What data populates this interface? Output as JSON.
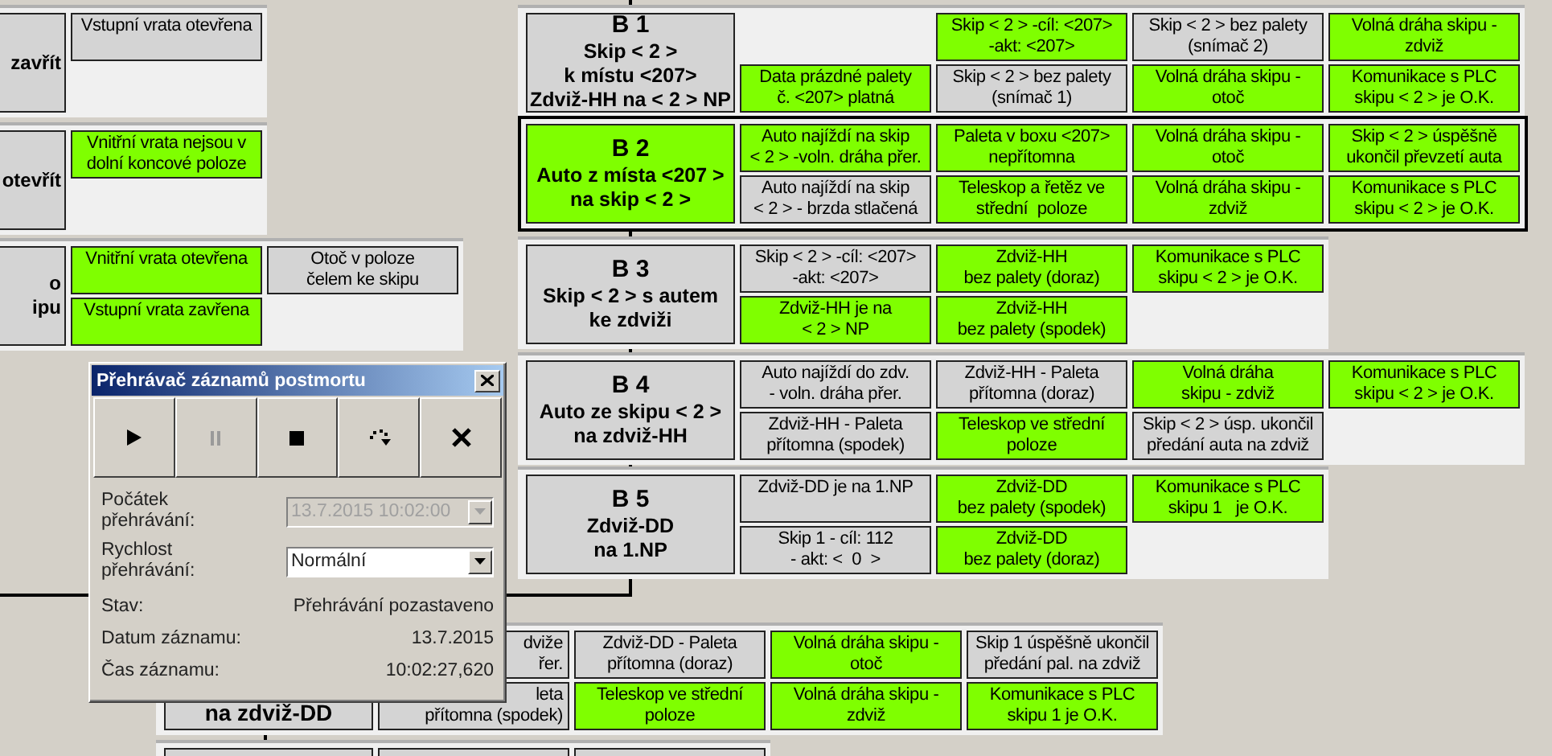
{
  "blocks": [
    {
      "selected": false,
      "title": {
        "on": false,
        "text": "zavřít"
      },
      "rows": [
        [
          {
            "text": "Vstupní vrata otevřena",
            "on": false
          }
        ]
      ]
    },
    {
      "selected": false,
      "title": {
        "on": false,
        "text": "otevřít"
      },
      "rows": [
        [
          {
            "text": "Vnitřní vrata nejsou v\ndolní koncové poloze",
            "on": true
          }
        ]
      ]
    },
    {
      "selected": false,
      "title": {
        "on": false,
        "text": "o\nipu"
      },
      "rows": [
        [
          {
            "text": "Vnitřní vrata otevřena",
            "on": true
          },
          {
            "text": "Otoč v poloze\nčelem ke skipu",
            "on": false
          }
        ],
        [
          {
            "text": "Vstupní vrata zavřena",
            "on": true
          }
        ]
      ]
    },
    {
      "selected": false,
      "title": {
        "on": false,
        "code": "B 1",
        "text": "Skip < 2 >\nk místu <207>\nZdviž-HH na < 2 > NP"
      },
      "rows": [
        [
          null,
          {
            "text": "Skip < 2 > -cíl: <207>\n-akt: <207>",
            "on": true
          },
          {
            "text": "Skip < 2 > bez palety\n(snímač 2)",
            "on": false
          },
          {
            "text": "Volná dráha skipu -\nzdviž",
            "on": true
          }
        ],
        [
          {
            "text": "Data prázdné palety\nč. <207> platná",
            "on": true
          },
          {
            "text": "Skip < 2 > bez palety\n(snímač 1)",
            "on": false
          },
          {
            "text": "Volná dráha skipu -\notoč",
            "on": true
          },
          {
            "text": "Komunikace s PLC\nskipu < 2 > je O.K.",
            "on": true
          }
        ]
      ]
    },
    {
      "selected": true,
      "title": {
        "on": true,
        "code": "B 2",
        "text": "Auto z místa <207 >\nna skip < 2 >"
      },
      "rows": [
        [
          {
            "text": "Auto najíždí na skip\n< 2 > -voln. dráha přer.",
            "on": true
          },
          {
            "text": "Paleta v boxu <207>\nnepřítomna",
            "on": true
          },
          {
            "text": "Volná dráha skipu -\notoč",
            "on": true
          },
          {
            "text": "Skip < 2 > úspěšně\nukončil převzetí auta",
            "on": true
          }
        ],
        [
          {
            "text": "Auto najíždí na skip\n< 2 > - brzda stlačená",
            "on": false
          },
          {
            "text": "Teleskop a řetěz ve\nstřední  poloze",
            "on": true
          },
          {
            "text": "Volná dráha skipu -\nzdviž",
            "on": true
          },
          {
            "text": "Komunikace s PLC\nskipu < 2 > je O.K.",
            "on": true
          }
        ]
      ]
    },
    {
      "selected": false,
      "title": {
        "on": false,
        "code": "B 3",
        "text": "Skip < 2 > s autem\nke zdviži"
      },
      "rows": [
        [
          {
            "text": "Skip < 2 > -cíl: <207>\n-akt: <207>",
            "on": false
          },
          {
            "text": "Zdviž-HH\nbez palety (doraz)",
            "on": true
          },
          {
            "text": "Komunikace s PLC\nskipu < 2 > je O.K.",
            "on": true
          }
        ],
        [
          {
            "text": "Zdviž-HH je na\n< 2 > NP",
            "on": true
          },
          {
            "text": "Zdviž-HH\nbez palety (spodek)",
            "on": true
          }
        ]
      ]
    },
    {
      "selected": false,
      "title": {
        "on": false,
        "code": "B 4",
        "text": "Auto ze skipu < 2 >\nna zdviž-HH"
      },
      "rows": [
        [
          {
            "text": "Auto najíždí do zdv.\n- voln. dráha přer.",
            "on": false
          },
          {
            "text": "Zdviž-HH - Paleta\npřítomna (doraz)",
            "on": false
          },
          {
            "text": "Volná dráha\nskipu - zdviž",
            "on": true
          },
          {
            "text": "Komunikace s PLC\nskipu < 2 > je O.K.",
            "on": true
          }
        ],
        [
          {
            "text": "Zdviž-HH - Paleta\npřítomna (spodek)",
            "on": false
          },
          {
            "text": "Teleskop ve střední\npoloze",
            "on": true
          },
          {
            "text": "Skip < 2 > úsp. ukončil\npředání auta na zdviž",
            "on": false
          }
        ]
      ]
    },
    {
      "selected": false,
      "title": {
        "on": false,
        "code": "B 5",
        "text": "Zdviž-DD\nna 1.NP"
      },
      "rows": [
        [
          {
            "text": "Zdviž-DD je na 1.NP",
            "on": false
          },
          {
            "text": "Zdviž-DD\nbez palety (spodek)",
            "on": true
          },
          {
            "text": "Komunikace s PLC\nskipu 1   je O.K.",
            "on": true
          }
        ],
        [
          {
            "text": "Skip 1 - cíl: 112\n- akt: <  0  >",
            "on": false
          },
          {
            "text": "Zdviž-DD\nbez palety (doraz)",
            "on": true
          }
        ]
      ]
    },
    {
      "selected": false,
      "title": {
        "on": false,
        "text": "na zdviž-DD"
      },
      "rows": [
        [
          {
            "text": "dviže\nřer.",
            "on": false
          },
          {
            "text": "Zdviž-DD - Paleta\npřítomna (doraz)",
            "on": false
          },
          {
            "text": "Volná dráha skipu -\notoč",
            "on": true
          },
          {
            "text": "Skip 1 úspěšně ukončil\npředání pal. na zdviž",
            "on": false
          }
        ],
        [
          {
            "text": "leta\npřítomna (spodek)",
            "on": false
          },
          {
            "text": "Teleskop ve střední\npoloze",
            "on": true
          },
          {
            "text": "Volná dráha skipu -\nzdviž",
            "on": true
          },
          {
            "text": "Komunikace s PLC\nskipu 1 je O.K.",
            "on": true
          }
        ]
      ]
    },
    {
      "selected": false,
      "title": {
        "on": false
      },
      "rows": [
        [
          {
            "on": false
          },
          {
            "on": false
          }
        ]
      ]
    }
  ],
  "dialog": {
    "title": "Přehrávač záznamů postmortu",
    "toolbar": [
      {
        "kind": "play",
        "disabled": false
      },
      {
        "kind": "pause",
        "disabled": true
      },
      {
        "kind": "stop",
        "disabled": false
      },
      {
        "kind": "step",
        "disabled": false
      },
      {
        "kind": "close",
        "disabled": false
      }
    ],
    "fields": [
      {
        "label": "Počátek\npřehrávání:",
        "value": "13.7.2015 10:02:00",
        "disabled": true
      },
      {
        "label": "Rychlost\npřehrávání:",
        "value": "Normální",
        "disabled": false
      }
    ],
    "info": [
      {
        "label": "Stav:",
        "value": "Přehrávání pozastaveno"
      },
      {
        "label": "Datum záznamu:",
        "value": "13.7.2015"
      },
      {
        "label": "Čas záznamu:",
        "value": "10:02:27,620"
      }
    ]
  }
}
